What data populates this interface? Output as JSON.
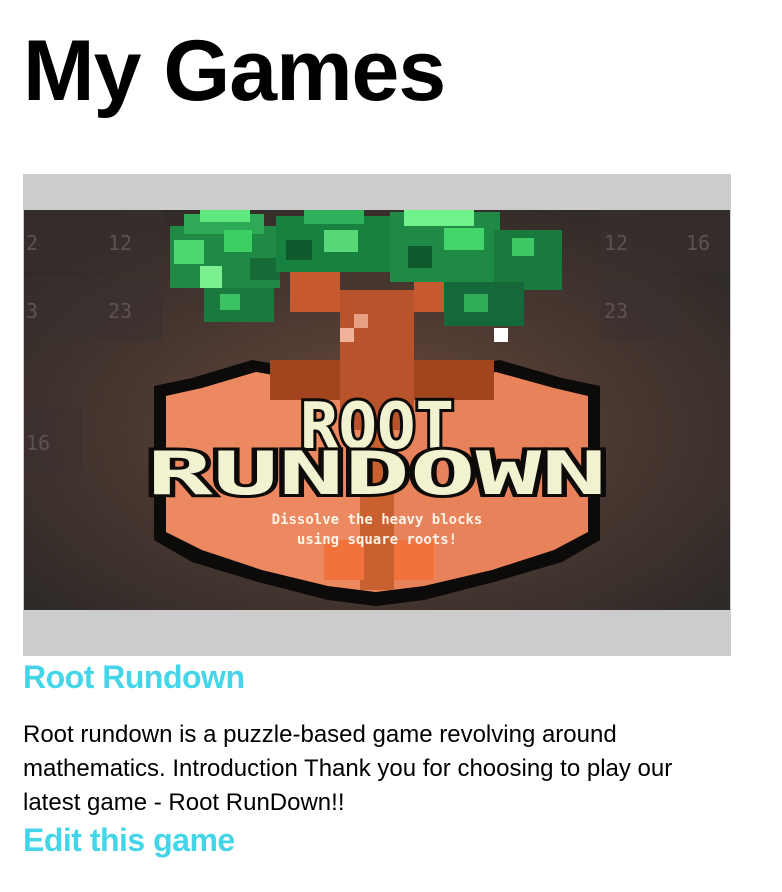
{
  "page": {
    "title": "My Games"
  },
  "game": {
    "title": "Root Rundown",
    "description": "Root rundown is a puzzle-based game revolving around mathematics. Introduction Thank you for choosing to play our latest game - Root RunDown!!",
    "edit_label": "Edit this game",
    "thumbnail": {
      "title_line1": "ROOT",
      "title_line2": "RUNDOWN",
      "tagline_line1": "Dissolve the heavy blocks",
      "tagline_line2": "using square roots!",
      "bg_numbers": [
        "2",
        "12",
        "12",
        "16",
        "3",
        "23",
        "23",
        "16"
      ]
    }
  },
  "colors": {
    "link": "#44d6e8",
    "frame": "#cccccc"
  }
}
